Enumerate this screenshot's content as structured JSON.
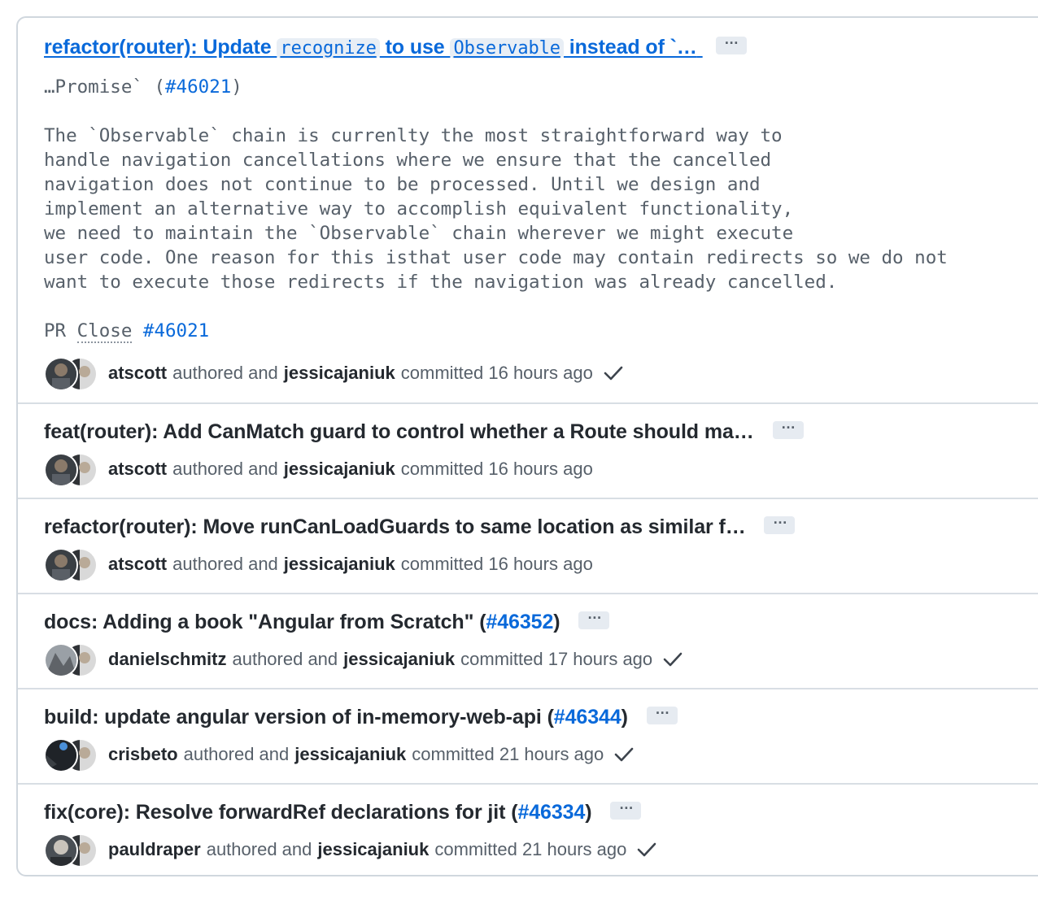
{
  "commits": [
    {
      "title_parts": [
        "refactor(router): Update ",
        "recognize",
        " to use ",
        "Observable",
        " instead of `…"
      ],
      "body_first": "…Promise` (",
      "body_first_link": "#46021",
      "body_first_end": ")",
      "body_lines": [
        "The `Observable` chain is currenlty the most straightforward way to",
        "handle navigation cancellations where we ensure that the cancelled",
        "navigation does not continue to be processed. Until we design and",
        "implement an alternative way to accomplish equivalent functionality,",
        "we need to maintain the `Observable` chain wherever we might execute",
        "user code. One reason for this isthat user code may contain redirects so we do not",
        "want to execute those redirects if the navigation was already cancelled."
      ],
      "pr_prefix": "PR ",
      "pr_close": "Close",
      "pr_link": "#46021",
      "author": "atscott",
      "authored_text": "authored and",
      "committer": "jessicajaniuk",
      "committed_text": "committed 16 hours ago",
      "verified": true
    },
    {
      "title": "feat(router): Add CanMatch guard to control whether a Route should ma…",
      "author": "atscott",
      "authored_text": "authored and",
      "committer": "jessicajaniuk",
      "committed_text": "committed 16 hours ago",
      "verified": false
    },
    {
      "title": "refactor(router): Move runCanLoadGuards to same location as similar f…",
      "author": "atscott",
      "authored_text": "authored and",
      "committer": "jessicajaniuk",
      "committed_text": "committed 16 hours ago",
      "verified": false
    },
    {
      "title": "docs: Adding a book \"Angular from Scratch\" (",
      "pr": "#46352",
      "title_end": ")",
      "author": "danielschmitz",
      "authored_text": "authored and",
      "committer": "jessicajaniuk",
      "committed_text": "committed 17 hours ago",
      "verified": true
    },
    {
      "title": "build: update angular version of in-memory-web-api (",
      "pr": "#46344",
      "title_end": ")",
      "author": "crisbeto",
      "authored_text": "authored and",
      "committer": "jessicajaniuk",
      "committed_text": "committed 21 hours ago",
      "verified": true
    },
    {
      "title": "fix(core): Resolve forwardRef declarations for jit (",
      "pr": "#46334",
      "title_end": ")",
      "author": "pauldraper",
      "authored_text": "authored and",
      "committer": "jessicajaniuk",
      "committed_text": "committed 21 hours ago",
      "verified": true
    }
  ],
  "ellipsis_label": "…",
  "icons": {
    "avatar": "avatar",
    "more": "ellipsis-icon",
    "check": "check-icon"
  }
}
